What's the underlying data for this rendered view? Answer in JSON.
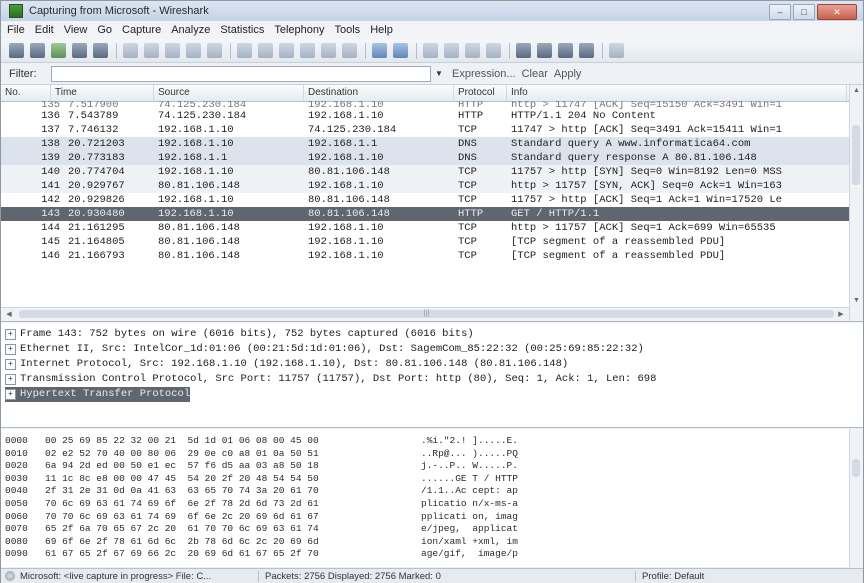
{
  "window": {
    "title": "Capturing from Microsoft - Wireshark"
  },
  "menu": [
    "File",
    "Edit",
    "View",
    "Go",
    "Capture",
    "Analyze",
    "Statistics",
    "Telephony",
    "Tools",
    "Help"
  ],
  "toolbar": {
    "icons": [
      "interface-list-icon",
      "capture-options-icon",
      "start-capture-icon",
      "stop-capture-icon",
      "restart-capture-icon",
      "open-file-icon",
      "save-file-icon",
      "close-file-icon",
      "reload-icon",
      "print-icon",
      "find-packet-icon",
      "go-back-icon",
      "go-forward-icon",
      "go-to-packet-icon",
      "go-first-icon",
      "go-last-icon",
      "colorize-icon",
      "auto-scroll-icon",
      "zoom-in-icon",
      "zoom-out-icon",
      "zoom-normal-icon",
      "resize-columns-icon",
      "capture-filters-icon",
      "display-filters-icon",
      "coloring-rules-icon",
      "preferences-icon",
      "help-icon"
    ]
  },
  "filter": {
    "label": "Filter:",
    "value": "",
    "expression_label": "Expression...",
    "clear_label": "Clear",
    "apply_label": "Apply"
  },
  "packet_list": {
    "columns": [
      "No.",
      "Time",
      "Source",
      "Destination",
      "Protocol",
      "Info"
    ],
    "partial_row": [
      "135",
      "7.517900",
      "74.125.230.184",
      "192.168.1.10",
      "HTTP",
      "http > 11747 [ACK] Seq=15150 Ack=3491 Win=1"
    ],
    "rows": [
      {
        "no": "136",
        "time": "7.543789",
        "source": "74.125.230.184",
        "destination": "192.168.1.10",
        "protocol": "HTTP",
        "info": "HTTP/1.1 204 No Content",
        "bg": "#ffffff"
      },
      {
        "no": "137",
        "time": "7.746132",
        "source": "192.168.1.10",
        "destination": "74.125.230.184",
        "protocol": "TCP",
        "info": "11747 > http [ACK] Seq=3491 Ack=15411 Win=1",
        "bg": "#ffffff"
      },
      {
        "no": "138",
        "time": "20.721203",
        "source": "192.168.1.10",
        "destination": "192.168.1.1",
        "protocol": "DNS",
        "info": "Standard query A www.informatica64.com",
        "bg": "#dde3ec"
      },
      {
        "no": "139",
        "time": "20.773183",
        "source": "192.168.1.1",
        "destination": "192.168.1.10",
        "protocol": "DNS",
        "info": "Standard query response A 80.81.106.148",
        "bg": "#dde3ec"
      },
      {
        "no": "140",
        "time": "20.774704",
        "source": "192.168.1.10",
        "destination": "80.81.106.148",
        "protocol": "TCP",
        "info": "11757 > http [SYN] Seq=0 Win=8192 Len=0 MSS",
        "bg": "#eef1f5"
      },
      {
        "no": "141",
        "time": "20.929767",
        "source": "80.81.106.148",
        "destination": "192.168.1.10",
        "protocol": "TCP",
        "info": "http > 11757 [SYN, ACK] Seq=0 Ack=1 Win=163",
        "bg": "#eef1f5"
      },
      {
        "no": "142",
        "time": "20.929826",
        "source": "192.168.1.10",
        "destination": "80.81.106.148",
        "protocol": "TCP",
        "info": "11757 > http [ACK] Seq=1 Ack=1 Win=17520 Le",
        "bg": "#ffffff"
      },
      {
        "no": "143",
        "time": "20.930480",
        "source": "192.168.1.10",
        "destination": "80.81.106.148",
        "protocol": "HTTP",
        "info": "GET / HTTP/1.1",
        "bg": "#5f6670",
        "selected": true
      },
      {
        "no": "144",
        "time": "21.161295",
        "source": "80.81.106.148",
        "destination": "192.168.1.10",
        "protocol": "TCP",
        "info": "http > 11757 [ACK] Seq=1 Ack=699 Win=65535",
        "bg": "#ffffff"
      },
      {
        "no": "145",
        "time": "21.164805",
        "source": "80.81.106.148",
        "destination": "192.168.1.10",
        "protocol": "TCP",
        "info": "[TCP segment of a reassembled PDU]",
        "bg": "#ffffff"
      },
      {
        "no": "146",
        "time": "21.166793",
        "source": "80.81.106.148",
        "destination": "192.168.1.10",
        "protocol": "TCP",
        "info": "[TCP segment of a reassembled PDU]",
        "bg": "#ffffff"
      }
    ]
  },
  "details": [
    {
      "text": "Frame 143: 752 bytes on wire (6016 bits), 752 bytes captured (6016 bits)",
      "highlight": false
    },
    {
      "text": "Ethernet II, Src: IntelCor_1d:01:06 (00:21:5d:1d:01:06), Dst: SagemCom_85:22:32 (00:25:69:85:22:32)",
      "highlight": false
    },
    {
      "text": "Internet Protocol, Src: 192.168.1.10 (192.168.1.10), Dst: 80.81.106.148 (80.81.106.148)",
      "highlight": false
    },
    {
      "text": "Transmission Control Protocol, Src Port: 11757 (11757), Dst Port: http (80), Seq: 1, Ack: 1, Len: 698",
      "highlight": false
    },
    {
      "text": "Hypertext Transfer Protocol",
      "highlight": true
    }
  ],
  "hex": [
    {
      "offset": "0000",
      "hex": "00 25 69 85 22 32 00 21  5d 1d 01 06 08 00 45 00",
      "ascii": ".%i.\"2.! ].....E."
    },
    {
      "offset": "0010",
      "hex": "02 e2 52 70 40 00 80 06  29 0e c0 a8 01 0a 50 51",
      "ascii": "..Rp@... ).....PQ"
    },
    {
      "offset": "0020",
      "hex": "6a 94 2d ed 00 50 e1 ec  57 f6 d5 aa 03 a8 50 18",
      "ascii": "j.-..P.. W.....P."
    },
    {
      "offset": "0030",
      "hex": "11 1c 8c e8 00 00 47 45  54 20 2f 20 48 54 54 50",
      "ascii": "......GE T / HTTP"
    },
    {
      "offset": "0040",
      "hex": "2f 31 2e 31 0d 0a 41 63  63 65 70 74 3a 20 61 70",
      "ascii": "/1.1..Ac cept: ap"
    },
    {
      "offset": "0050",
      "hex": "70 6c 69 63 61 74 69 6f  6e 2f 78 2d 6d 73 2d 61",
      "ascii": "plicatio n/x-ms-a"
    },
    {
      "offset": "0060",
      "hex": "70 70 6c 69 63 61 74 69  6f 6e 2c 20 69 6d 61 67",
      "ascii": "pplicati on, imag"
    },
    {
      "offset": "0070",
      "hex": "65 2f 6a 70 65 67 2c 20  61 70 70 6c 69 63 61 74",
      "ascii": "e/jpeg,  applicat"
    },
    {
      "offset": "0080",
      "hex": "69 6f 6e 2f 78 61 6d 6c  2b 78 6d 6c 2c 20 69 6d",
      "ascii": "ion/xaml +xml, im"
    },
    {
      "offset": "0090",
      "hex": "61 67 65 2f 67 69 66 2c  20 69 6d 61 67 65 2f 70",
      "ascii": "age/gif,  image/p"
    }
  ],
  "status": {
    "left": "Microsoft: <live capture in progress> File: C...",
    "middle": "Packets: 2756 Displayed: 2756 Marked: 0",
    "right": "Profile: Default"
  },
  "colors": {
    "selected_row": "#5f6670",
    "dns_row": "#dde3ec",
    "tcp_syn_row": "#eef1f5",
    "highlight_detail": "#5f6670"
  }
}
